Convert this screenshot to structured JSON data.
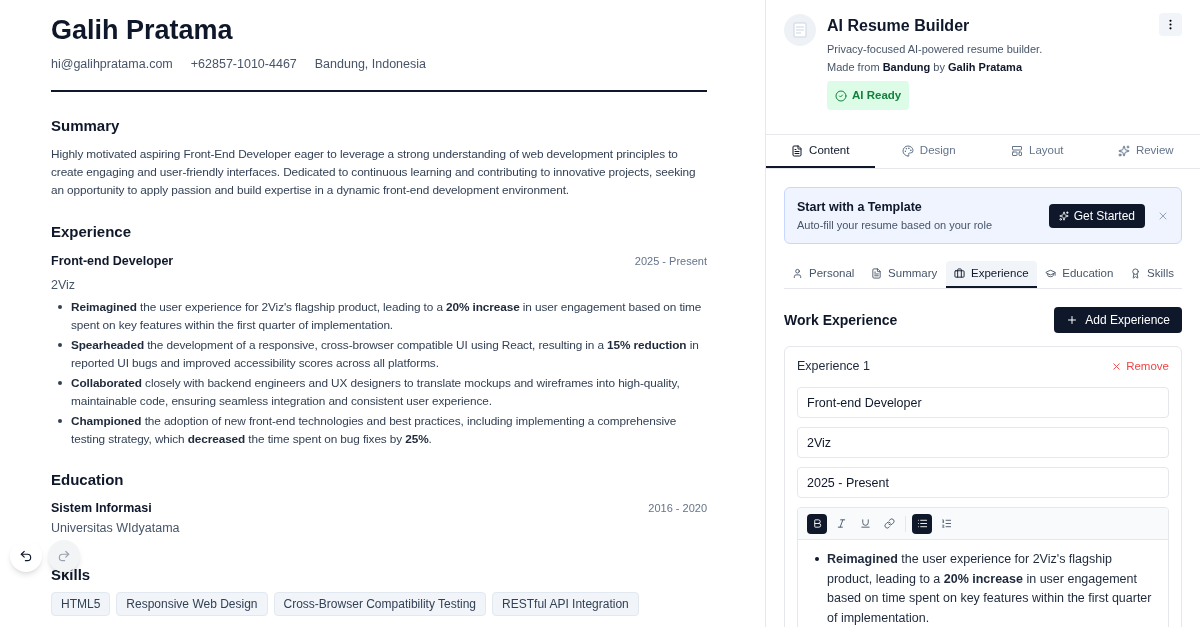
{
  "resume": {
    "name": "Galih Pratama",
    "contacts": [
      "hi@galihpratama.com",
      "+62857-1010-4467",
      "Bandung, Indonesia"
    ],
    "summary": {
      "heading": "Summary",
      "text": "Highly motivated aspiring Front-End Developer eager to leverage a strong understanding of web development principles to create engaging and user-friendly interfaces. Dedicated to continuous learning and contributing to innovative projects, seeking an opportunity to apply passion and build expertise in a dynamic front-end development environment."
    },
    "experience": {
      "heading": "Experience",
      "items": [
        {
          "title": "Front-end Developer",
          "date": "2025 - Present",
          "company": "2Viz",
          "bullets": [
            "**Reimagined** the user experience for 2Viz's flagship product, leading to a **20% increase** in user engagement based on time spent on key features within the first quarter of implementation.",
            "**Spearheaded** the development of a responsive, cross-browser compatible UI using React, resulting in a **15% reduction** in reported UI bugs and improved accessibility scores across all platforms.",
            "**Collaborated** closely with backend engineers and UX designers to translate mockups and wireframes into high-quality, maintainable code, ensuring seamless integration and consistent user experience.",
            "**Championed** the adoption of new front-end technologies and best practices, including implementing a comprehensive testing strategy, which **decreased** the time spent on bug fixes by **25%**."
          ]
        }
      ]
    },
    "education": {
      "heading": "Education",
      "items": [
        {
          "degree": "Sistem Informasi",
          "date": "2016 - 2020",
          "school": "Universitas WIdyatama"
        }
      ]
    },
    "skills": {
      "heading": "Skills",
      "items": [
        "HTML5",
        "Responsive Web Design",
        "Cross-Browser Compatibility Testing",
        "RESTful API Integration"
      ]
    }
  },
  "history": {
    "undo": {
      "disabled": false
    },
    "redo": {
      "disabled": true
    }
  },
  "app": {
    "title": "AI Resume Builder",
    "tagline": "Privacy-focused AI-powered resume builder.",
    "credit": "Made from **Bandung** by **Galih Pratama**",
    "status": "AI Ready"
  },
  "tabs": [
    {
      "label": "Content",
      "selected": true
    },
    {
      "label": "Design",
      "selected": false
    },
    {
      "label": "Layout",
      "selected": false
    },
    {
      "label": "Review",
      "selected": false
    }
  ],
  "template_banner": {
    "title": "Start with a Template",
    "subtitle": "Auto-fill your resume based on your role",
    "button": "Get Started"
  },
  "section_tabs": [
    {
      "label": "Personal",
      "selected": false
    },
    {
      "label": "Summary",
      "selected": false
    },
    {
      "label": "Experience",
      "selected": true
    },
    {
      "label": "Education",
      "selected": false
    },
    {
      "label": "Skills",
      "selected": false
    }
  ],
  "work": {
    "heading": "Work Experience",
    "add_button": "Add Experience",
    "entries": [
      {
        "label": "Experience 1",
        "remove": "Remove",
        "fields": [
          "Front-end Developer",
          "2Viz",
          "2025 - Present"
        ],
        "toolbar": [
          {
            "kind": "bold",
            "active": true
          },
          {
            "kind": "italic",
            "active": false
          },
          {
            "kind": "underline",
            "active": false
          },
          {
            "kind": "link",
            "active": false
          },
          {
            "kind": "bullets",
            "active": true
          },
          {
            "kind": "numbered",
            "active": false
          }
        ],
        "bullets": [
          "**Reimagined** the user experience for 2Viz's flagship product, leading to a **20% increase** in user engagement based on time spent on key features within the first quarter of implementation."
        ]
      }
    ]
  }
}
